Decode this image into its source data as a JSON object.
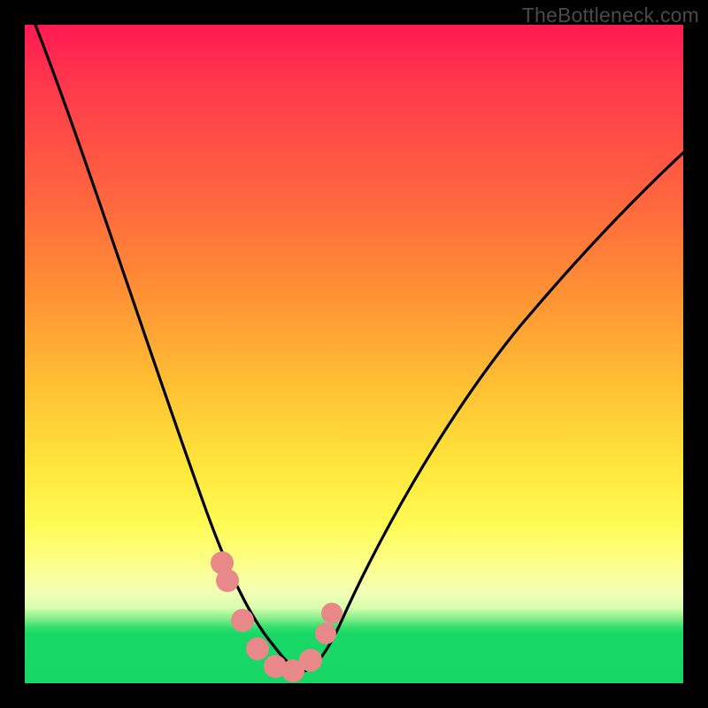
{
  "watermark": "TheBottleneck.com",
  "chart_data": {
    "type": "line",
    "title": "",
    "xlabel": "",
    "ylabel": "",
    "xlim": [
      0,
      1
    ],
    "ylim": [
      0,
      1
    ],
    "series": [
      {
        "name": "bottleneck-curve",
        "x": [
          0.0,
          0.05,
          0.1,
          0.15,
          0.2,
          0.25,
          0.3,
          0.33,
          0.36,
          0.39,
          0.42,
          0.45,
          0.5,
          0.55,
          0.6,
          0.65,
          0.7,
          0.75,
          0.8,
          0.85,
          0.9,
          0.95,
          1.0
        ],
        "values": [
          1.02,
          0.87,
          0.72,
          0.58,
          0.45,
          0.32,
          0.19,
          0.12,
          0.06,
          0.02,
          0.005,
          0.02,
          0.07,
          0.15,
          0.24,
          0.33,
          0.41,
          0.48,
          0.54,
          0.59,
          0.63,
          0.66,
          0.685
        ]
      }
    ],
    "markers": {
      "name": "highlight-points",
      "x": [
        0.295,
        0.301,
        0.32,
        0.345,
        0.375,
        0.4,
        0.43,
        0.448,
        0.455
      ],
      "values": [
        0.17,
        0.145,
        0.085,
        0.035,
        0.01,
        0.01,
        0.035,
        0.08,
        0.11
      ]
    },
    "gradient_stops": [
      {
        "pos": 0.0,
        "color": "#ff1a52"
      },
      {
        "pos": 0.28,
        "color": "#ff6a3d"
      },
      {
        "pos": 0.55,
        "color": "#ffc133"
      },
      {
        "pos": 0.76,
        "color": "#fffb55"
      },
      {
        "pos": 0.9,
        "color": "#8fef8e"
      },
      {
        "pos": 1.0,
        "color": "#17d867"
      }
    ]
  }
}
